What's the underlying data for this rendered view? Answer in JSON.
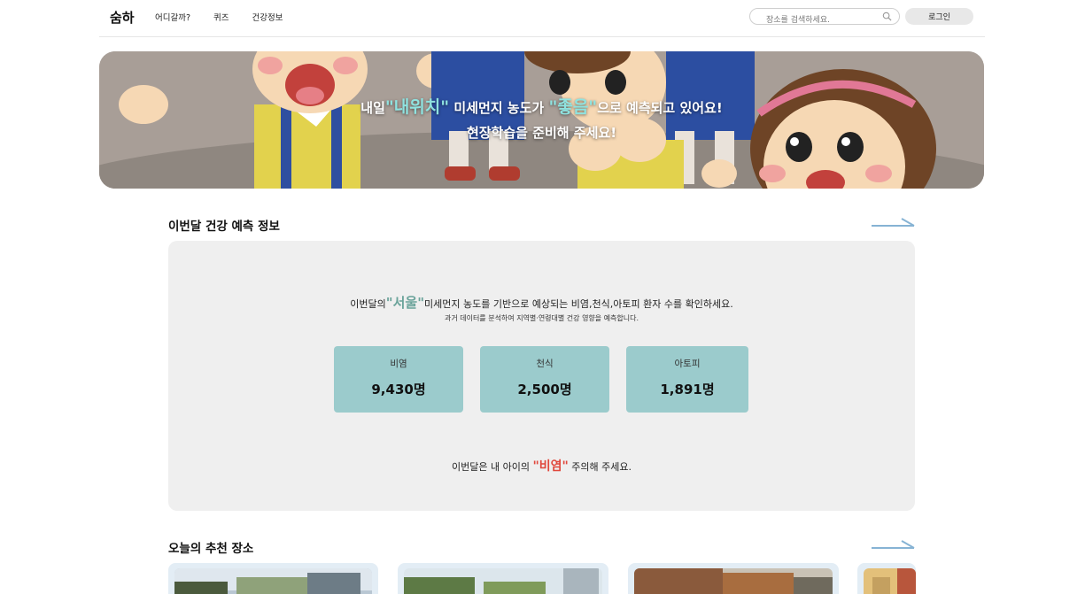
{
  "header": {
    "logo": "숨하",
    "nav": [
      "어디갈까?",
      "퀴즈",
      "건강정보"
    ],
    "search_placeholder": "장소를 검색하세요.",
    "login_label": "로그인"
  },
  "banner": {
    "line1_prefix": "내일",
    "line1_place": "\"내위치\"",
    "line1_mid": " 미세먼지 농도가 ",
    "line1_grade": "\"좋음\"",
    "line1_suffix": "으로 예측되고 있어요!",
    "line2": "현장학습을 준비해 주세요!"
  },
  "forecast": {
    "title": "이번달 건강 예측 정보",
    "line1_prefix": "이번달의",
    "city": "\"서울\"",
    "line1_suffix": "미세먼지 농도를 기반으로 예상되는 비염,천식,아토피 환자 수를 확인하세요.",
    "line2": "과거 데이터를 분석하여 지역별·연령대별 건강 영향을 예측합니다.",
    "stats": [
      {
        "label": "비염",
        "value": "9,430명"
      },
      {
        "label": "천식",
        "value": "2,500명"
      },
      {
        "label": "아토피",
        "value": "1,891명"
      }
    ],
    "note_prefix": "이번달은 내 아이의 ",
    "note_disease": "\"비염\"",
    "note_suffix": " 주의해 주세요."
  },
  "places": {
    "title": "오늘의 추천 장소"
  },
  "colors": {
    "accent_teal": "#9bcbcc",
    "city_highlight": "#6aa39a",
    "warning_red": "#e0473c",
    "card_bg": "#efefef"
  }
}
